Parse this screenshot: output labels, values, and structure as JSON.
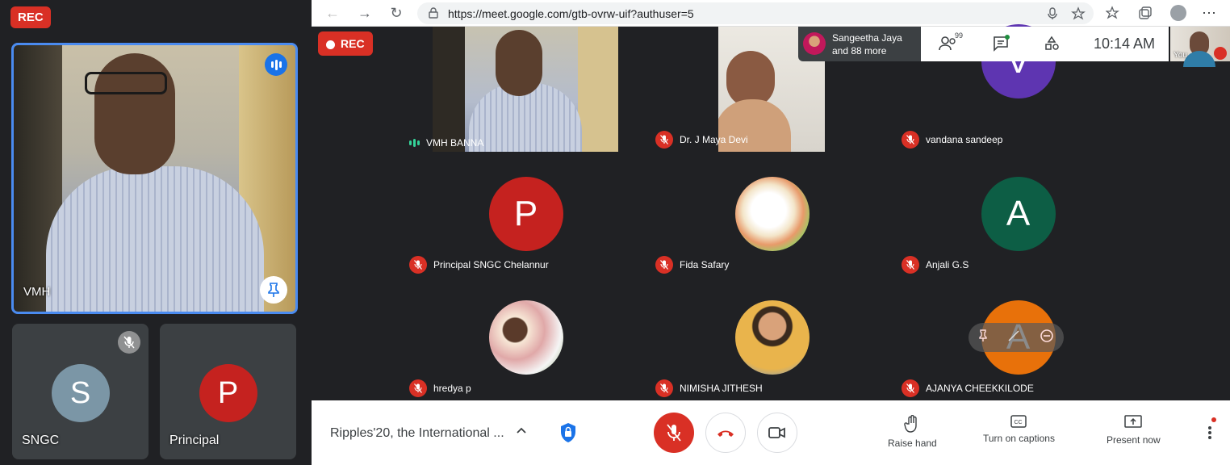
{
  "left_panel": {
    "rec": "REC",
    "main_tile": {
      "name": "VMH"
    },
    "tiles": [
      {
        "name": "SNGC",
        "initial": "S",
        "color": "#7b96a6"
      },
      {
        "name": "Principal",
        "initial": "P",
        "color": "#c5221f"
      }
    ]
  },
  "browser": {
    "url": "https://meet.google.com/gtb-ovrw-uif?authuser=5",
    "rec": "REC",
    "overlay": {
      "presenter_line1": "Sangeetha Jaya",
      "presenter_line2": "and 88 more",
      "participants_count": "99",
      "time": "10:14  AM",
      "self_label": "You"
    },
    "participants": [
      {
        "name": "VMH BANNA",
        "type": "video"
      },
      {
        "name": "Dr. J Maya Devi",
        "type": "video"
      },
      {
        "name": "vandana sandeep",
        "initial": "V",
        "color": "#5e35b1"
      },
      {
        "name": "Principal SNGC Chelannur",
        "initial": "P",
        "color": "#c5221f"
      },
      {
        "name": "Fida Safary",
        "type": "photo"
      },
      {
        "name": "Anjali G.S",
        "initial": "A",
        "color": "#0d5e45"
      },
      {
        "name": "hredya p",
        "type": "photo"
      },
      {
        "name": "NIMISHA JITHESH",
        "type": "photo"
      },
      {
        "name": "AJANYA CHEEKKILODE",
        "initial": "A",
        "color": "#e8710a"
      }
    ],
    "bottom": {
      "meeting_title": "Ripples'20, the International ...",
      "raise_hand": "Raise hand",
      "captions": "Turn on captions",
      "present": "Present now"
    }
  }
}
